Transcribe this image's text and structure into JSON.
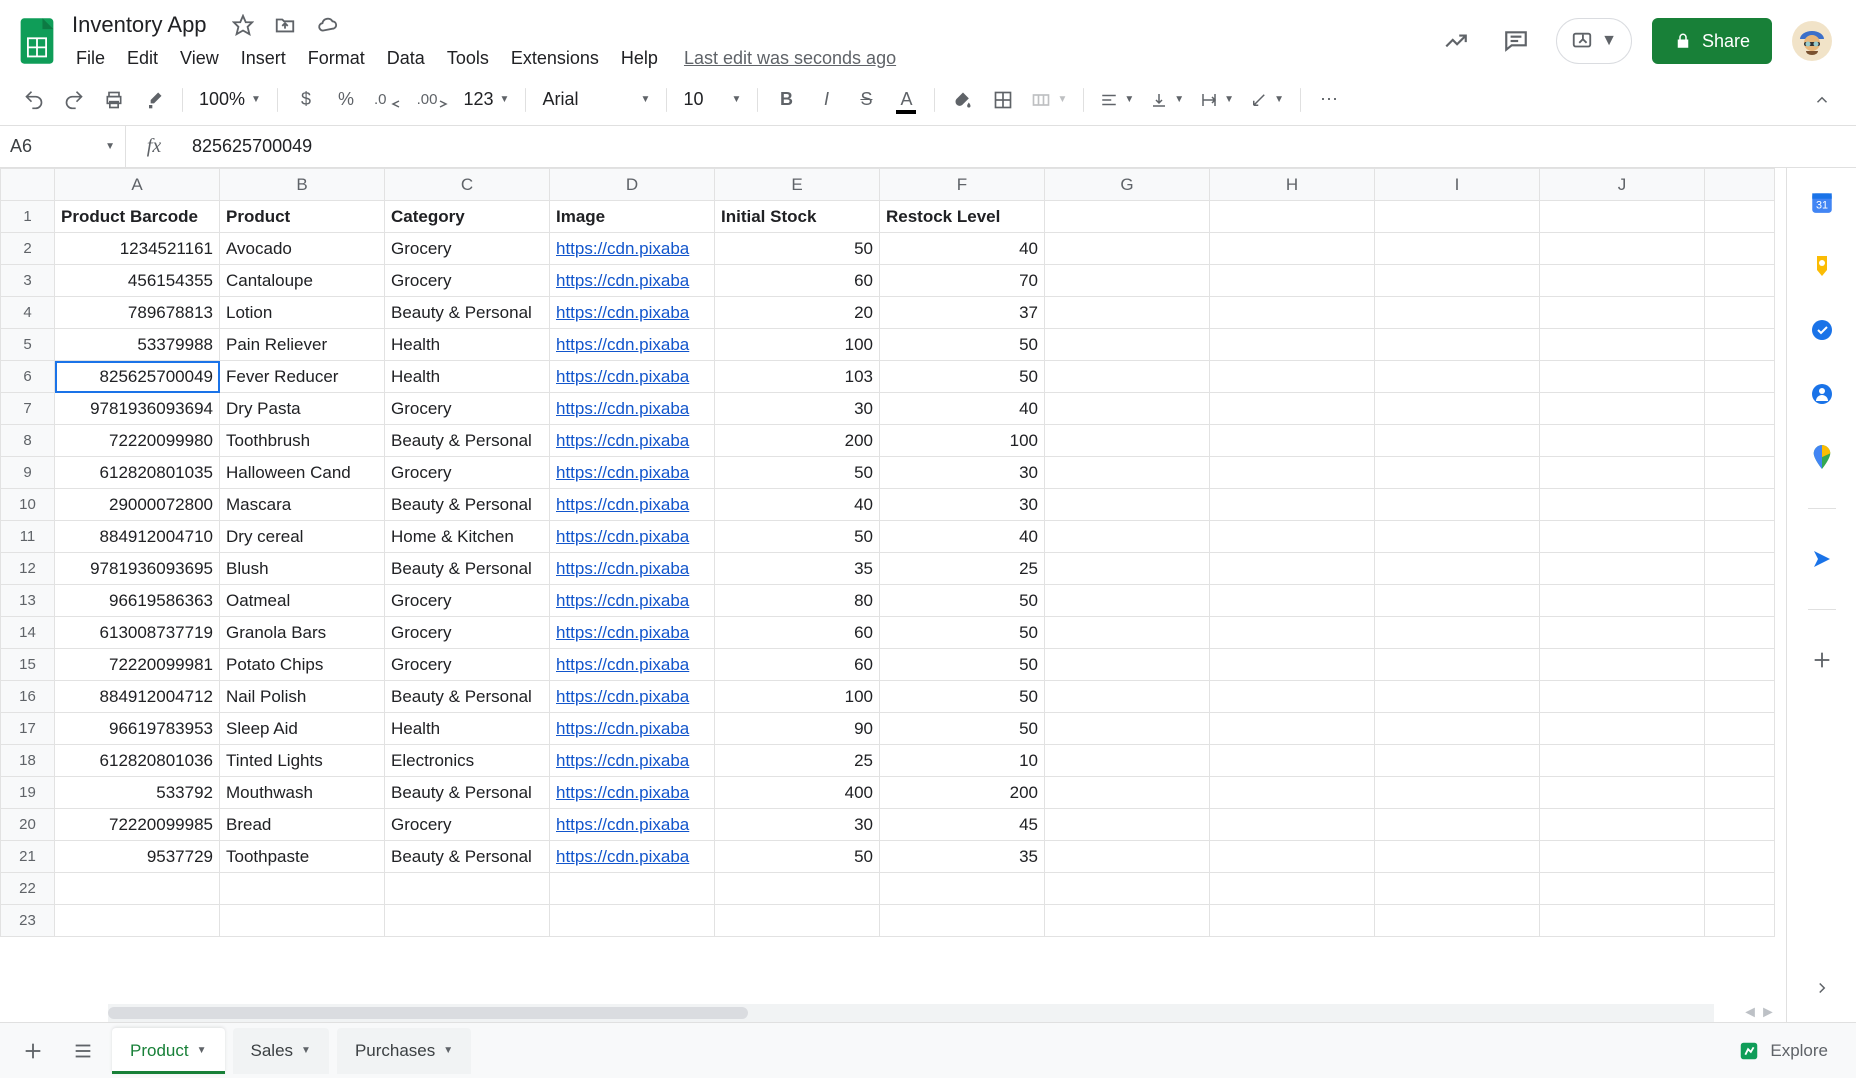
{
  "doc": {
    "title": "Inventory App",
    "last_edit": "Last edit was seconds ago"
  },
  "menu": {
    "file": "File",
    "edit": "Edit",
    "view": "View",
    "insert": "Insert",
    "format": "Format",
    "data": "Data",
    "tools": "Tools",
    "extensions": "Extensions",
    "help": "Help"
  },
  "toolbar": {
    "zoom": "100%",
    "font": "Arial",
    "fontsize": "10",
    "numfmt": "123"
  },
  "share": {
    "label": "Share"
  },
  "fx": {
    "cellref": "A6",
    "value": "825625700049"
  },
  "columns": [
    "A",
    "B",
    "C",
    "D",
    "E",
    "F",
    "G",
    "H",
    "I",
    "J"
  ],
  "headers": {
    "A": "Product Barcode",
    "B": "Product",
    "C": "Category",
    "D": "Image",
    "E": "Initial Stock",
    "F": "Restock Level"
  },
  "selected": {
    "row": 6,
    "col": "A"
  },
  "link_text": "https://cdn.pixaba",
  "rows": [
    {
      "A": "1234521161",
      "B": "Avocado",
      "C": "Grocery",
      "D": "link",
      "E": "50",
      "F": "40"
    },
    {
      "A": "456154355",
      "B": "Cantaloupe",
      "C": "Grocery",
      "D": "link",
      "E": "60",
      "F": "70"
    },
    {
      "A": "789678813",
      "B": "Lotion",
      "C": "Beauty & Personal",
      "D": "link",
      "E": "20",
      "F": "37"
    },
    {
      "A": "53379988",
      "B": "Pain Reliever",
      "C": "Health",
      "D": "link",
      "E": "100",
      "F": "50"
    },
    {
      "A": "825625700049",
      "B": "Fever Reducer",
      "C": "Health",
      "D": "link",
      "E": "103",
      "F": "50"
    },
    {
      "A": "9781936093694",
      "B": "Dry Pasta",
      "C": "Grocery",
      "D": "link",
      "E": "30",
      "F": "40"
    },
    {
      "A": "72220099980",
      "B": "Toothbrush",
      "C": "Beauty & Personal",
      "D": "link",
      "E": "200",
      "F": "100"
    },
    {
      "A": "612820801035",
      "B": "Halloween Cand",
      "C": "Grocery",
      "D": "link",
      "E": "50",
      "F": "30"
    },
    {
      "A": "29000072800",
      "B": "Mascara",
      "C": "Beauty & Personal",
      "D": "link",
      "E": "40",
      "F": "30"
    },
    {
      "A": "884912004710",
      "B": "Dry cereal",
      "C": "Home & Kitchen",
      "D": "link",
      "E": "50",
      "F": "40"
    },
    {
      "A": "9781936093695",
      "B": "Blush",
      "C": "Beauty & Personal",
      "D": "link",
      "E": "35",
      "F": "25"
    },
    {
      "A": "96619586363",
      "B": "Oatmeal",
      "C": "Grocery",
      "D": "link",
      "E": "80",
      "F": "50"
    },
    {
      "A": "613008737719",
      "B": "Granola Bars",
      "C": "Grocery",
      "D": "link",
      "E": "60",
      "F": "50"
    },
    {
      "A": "72220099981",
      "B": "Potato Chips",
      "C": "Grocery",
      "D": "link",
      "E": "60",
      "F": "50"
    },
    {
      "A": "884912004712",
      "B": "Nail Polish",
      "C": "Beauty & Personal",
      "D": "link",
      "E": "100",
      "F": "50"
    },
    {
      "A": "96619783953",
      "B": "Sleep Aid",
      "C": "Health",
      "D": "link",
      "E": "90",
      "F": "50"
    },
    {
      "A": "612820801036",
      "B": "Tinted Lights",
      "C": "Electronics",
      "D": "link",
      "E": "25",
      "F": "10"
    },
    {
      "A": "533792",
      "B": "Mouthwash",
      "C": "Beauty & Personal",
      "D": "link",
      "E": "400",
      "F": "200"
    },
    {
      "A": "72220099985",
      "B": "Bread",
      "C": "Grocery",
      "D": "link",
      "E": "30",
      "F": "45"
    },
    {
      "A": "9537729",
      "B": "Toothpaste",
      "C": "Beauty & Personal",
      "D": "link",
      "E": "50",
      "F": "35"
    }
  ],
  "extra_rows": 2,
  "tabs": {
    "active": "Product",
    "others": [
      "Sales",
      "Purchases"
    ]
  },
  "explore": {
    "label": "Explore"
  }
}
